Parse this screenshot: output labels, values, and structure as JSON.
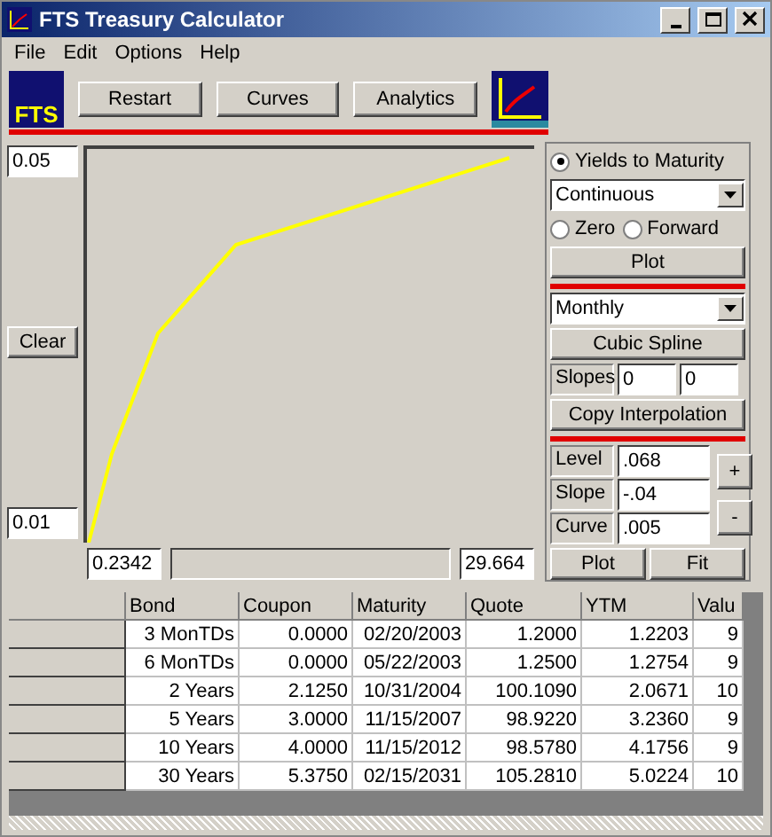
{
  "window": {
    "title": "FTS Treasury Calculator"
  },
  "menu": [
    {
      "label": "File"
    },
    {
      "label": "Edit"
    },
    {
      "label": "Options"
    },
    {
      "label": "Help"
    }
  ],
  "toolbar": {
    "logo_text": "FTS",
    "buttons": [
      "Restart",
      "Curves",
      "Analytics"
    ]
  },
  "plot": {
    "y_max": "0.05",
    "y_min": "0.01",
    "clear_button": "Clear",
    "x_min": "0.2342",
    "x_max": "29.664"
  },
  "panel": {
    "radios": [
      {
        "label": "Yields to Maturity",
        "selected": true
      },
      {
        "label": "Zero",
        "selected": false
      },
      {
        "label": "Forward",
        "selected": false
      }
    ],
    "compounding": "Continuous",
    "plot_button": "Plot",
    "frequency": "Monthly",
    "interpolation_button": "Cubic Spline",
    "slopes": {
      "label": "Slopes",
      "values": [
        "0",
        "0"
      ]
    },
    "copy_button": "Copy Interpolation",
    "parameters": [
      {
        "label": "Level",
        "value": ".068"
      },
      {
        "label": "Slope",
        "value": "-.04"
      },
      {
        "label": "Curve",
        "value": ".005"
      }
    ],
    "step_buttons": [
      "+",
      "-"
    ],
    "bottom_buttons": [
      "Plot",
      "Fit"
    ]
  },
  "table": {
    "columns": [
      "Bond",
      "Coupon",
      "Maturity",
      "Quote",
      "YTM",
      "Valu"
    ],
    "rows": [
      [
        "3 MonTDs",
        "0.0000",
        "02/20/2003",
        "1.2000",
        "1.2203",
        "9"
      ],
      [
        "6 MonTDs",
        "0.0000",
        "05/22/2003",
        "1.2500",
        "1.2754",
        "9"
      ],
      [
        "2 Years",
        "2.1250",
        "10/31/2004",
        "100.1090",
        "2.0671",
        "10"
      ],
      [
        "5 Years",
        "3.0000",
        "11/15/2007",
        "98.9220",
        "3.2360",
        "9"
      ],
      [
        "10 Years",
        "4.0000",
        "11/15/2012",
        "98.5780",
        "4.1756",
        "9"
      ],
      [
        "30 Years",
        "5.3750",
        "02/15/2031",
        "105.2810",
        "5.0224",
        "10"
      ]
    ]
  }
}
